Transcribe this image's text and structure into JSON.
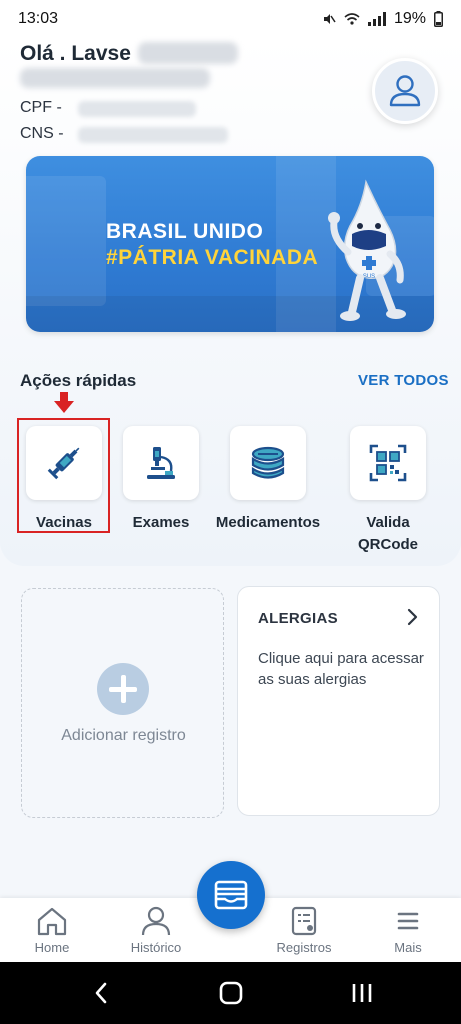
{
  "status_bar": {
    "time": "13:03",
    "battery": "19%",
    "icons": [
      "mute-icon",
      "wifi-icon",
      "signal-icon",
      "battery-icon"
    ]
  },
  "header": {
    "greeting": "Olá . Lavse",
    "cpf_label": "CPF -",
    "cns_label": "CNS -"
  },
  "banner": {
    "line1": "BRASIL UNIDO",
    "line2": "#PÁTRIA VACINADA",
    "mascot_badge": "SUS",
    "colors": {
      "background": "#2f7bd3",
      "highlight": "#ffd43a"
    }
  },
  "quick_actions": {
    "title": "Ações rápidas",
    "see_all": "VER TODOS",
    "items": [
      {
        "label": "Vacinas",
        "icon": "syringe-icon"
      },
      {
        "label": "Exames",
        "icon": "microscope-icon"
      },
      {
        "label": "Medicamentos",
        "icon": "pills-icon"
      },
      {
        "label": "Valida",
        "label2": "QRCode",
        "icon": "qrcode-icon"
      }
    ]
  },
  "cards": {
    "add_record": {
      "label": "Adicionar registro"
    },
    "allergies": {
      "title": "ALERGIAS",
      "description": "Clique aqui para acessar as suas alergias"
    }
  },
  "bottom_nav": {
    "items": [
      {
        "label": "Home",
        "icon": "home-icon"
      },
      {
        "label": "Histórico",
        "icon": "person-icon"
      },
      {
        "label": "Registros",
        "icon": "records-icon"
      },
      {
        "label": "Mais",
        "icon": "menu-icon"
      }
    ],
    "fab_icon": "wallet-icon"
  },
  "colors": {
    "primary": "#1570cf",
    "accent_red": "#d92323",
    "text": "#1f2a36"
  }
}
